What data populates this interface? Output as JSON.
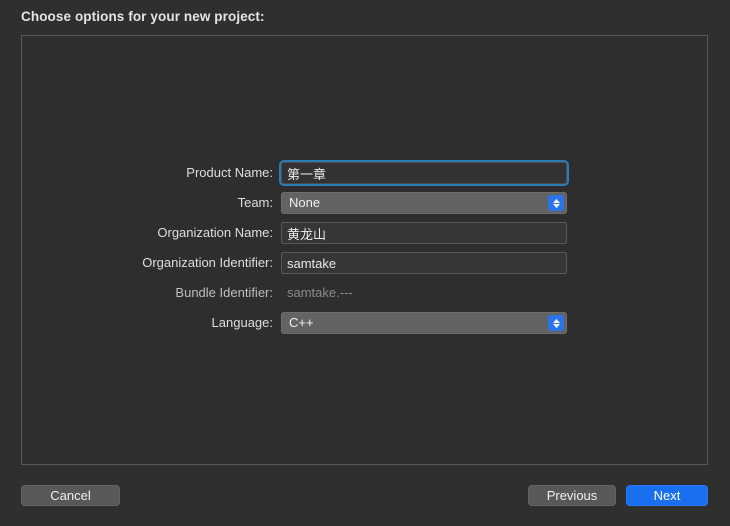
{
  "dialog": {
    "prompt": "Choose options for your new project:"
  },
  "form": {
    "fields": [
      {
        "label": "Product Name:",
        "type": "textfield",
        "value": "第一章",
        "placeholder": "",
        "focused": true,
        "name": "product-name"
      },
      {
        "label": "Team:",
        "type": "popup",
        "value": "None",
        "name": "team"
      },
      {
        "label": "Organization Name:",
        "type": "textfield",
        "value": "黄龙山",
        "placeholder": "",
        "focused": false,
        "name": "organization-name"
      },
      {
        "label": "Organization Identifier:",
        "type": "textfield",
        "value": "samtake",
        "placeholder": "",
        "focused": false,
        "name": "organization-identifier"
      },
      {
        "label": "Bundle Identifier:",
        "type": "static",
        "value": "samtake.---",
        "name": "bundle-identifier"
      },
      {
        "label": "Language:",
        "type": "popup",
        "value": "C++",
        "name": "language"
      }
    ]
  },
  "footer": {
    "cancel_label": "Cancel",
    "previous_label": "Previous",
    "next_label": "Next"
  },
  "colors": {
    "window_background": "#2f2f2f",
    "panel_background": "#2e2e2e",
    "panel_border": "#585858",
    "field_background": "#363636",
    "focus_ring": "#2a7cb8",
    "popup_background": "#636363",
    "accent_blue": "#1a6ff0",
    "stepper_blue": "#2a73e8",
    "disabled_text": "#8b8b8b"
  },
  "icons": {
    "stepper": "chevron-up-down-icon"
  }
}
